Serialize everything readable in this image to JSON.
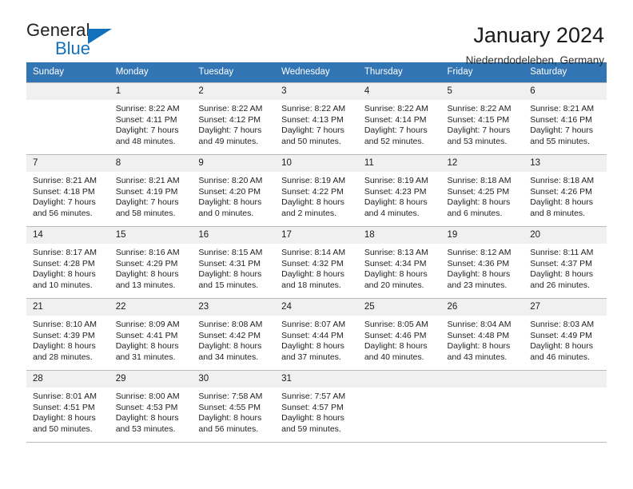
{
  "brand": {
    "name_dark": "General",
    "name_blue": "Blue",
    "accent_color": "#1271ba"
  },
  "header": {
    "title": "January 2024",
    "subtitle": "Niederndodeleben, Germany",
    "header_bg_color": "#3275b4",
    "daynum_bg_color": "#f0f0f0"
  },
  "weekday_headers": [
    "Sunday",
    "Monday",
    "Tuesday",
    "Wednesday",
    "Thursday",
    "Friday",
    "Saturday"
  ],
  "labels": {
    "sunrise_prefix": "Sunrise:",
    "sunset_prefix": "Sunset:",
    "daylight_prefix": "Daylight:"
  },
  "weeks": [
    [
      {
        "day": "",
        "blank": true,
        "line1": "",
        "line2": "",
        "line3": "",
        "line4": ""
      },
      {
        "day": "1",
        "line1": "Sunrise: 8:22 AM",
        "line2": "Sunset: 4:11 PM",
        "line3": "Daylight: 7 hours",
        "line4": "and 48 minutes."
      },
      {
        "day": "2",
        "line1": "Sunrise: 8:22 AM",
        "line2": "Sunset: 4:12 PM",
        "line3": "Daylight: 7 hours",
        "line4": "and 49 minutes."
      },
      {
        "day": "3",
        "line1": "Sunrise: 8:22 AM",
        "line2": "Sunset: 4:13 PM",
        "line3": "Daylight: 7 hours",
        "line4": "and 50 minutes."
      },
      {
        "day": "4",
        "line1": "Sunrise: 8:22 AM",
        "line2": "Sunset: 4:14 PM",
        "line3": "Daylight: 7 hours",
        "line4": "and 52 minutes."
      },
      {
        "day": "5",
        "line1": "Sunrise: 8:22 AM",
        "line2": "Sunset: 4:15 PM",
        "line3": "Daylight: 7 hours",
        "line4": "and 53 minutes."
      },
      {
        "day": "6",
        "line1": "Sunrise: 8:21 AM",
        "line2": "Sunset: 4:16 PM",
        "line3": "Daylight: 7 hours",
        "line4": "and 55 minutes."
      }
    ],
    [
      {
        "day": "7",
        "line1": "Sunrise: 8:21 AM",
        "line2": "Sunset: 4:18 PM",
        "line3": "Daylight: 7 hours",
        "line4": "and 56 minutes."
      },
      {
        "day": "8",
        "line1": "Sunrise: 8:21 AM",
        "line2": "Sunset: 4:19 PM",
        "line3": "Daylight: 7 hours",
        "line4": "and 58 minutes."
      },
      {
        "day": "9",
        "line1": "Sunrise: 8:20 AM",
        "line2": "Sunset: 4:20 PM",
        "line3": "Daylight: 8 hours",
        "line4": "and 0 minutes."
      },
      {
        "day": "10",
        "line1": "Sunrise: 8:19 AM",
        "line2": "Sunset: 4:22 PM",
        "line3": "Daylight: 8 hours",
        "line4": "and 2 minutes."
      },
      {
        "day": "11",
        "line1": "Sunrise: 8:19 AM",
        "line2": "Sunset: 4:23 PM",
        "line3": "Daylight: 8 hours",
        "line4": "and 4 minutes."
      },
      {
        "day": "12",
        "line1": "Sunrise: 8:18 AM",
        "line2": "Sunset: 4:25 PM",
        "line3": "Daylight: 8 hours",
        "line4": "and 6 minutes."
      },
      {
        "day": "13",
        "line1": "Sunrise: 8:18 AM",
        "line2": "Sunset: 4:26 PM",
        "line3": "Daylight: 8 hours",
        "line4": "and 8 minutes."
      }
    ],
    [
      {
        "day": "14",
        "line1": "Sunrise: 8:17 AM",
        "line2": "Sunset: 4:28 PM",
        "line3": "Daylight: 8 hours",
        "line4": "and 10 minutes."
      },
      {
        "day": "15",
        "line1": "Sunrise: 8:16 AM",
        "line2": "Sunset: 4:29 PM",
        "line3": "Daylight: 8 hours",
        "line4": "and 13 minutes."
      },
      {
        "day": "16",
        "line1": "Sunrise: 8:15 AM",
        "line2": "Sunset: 4:31 PM",
        "line3": "Daylight: 8 hours",
        "line4": "and 15 minutes."
      },
      {
        "day": "17",
        "line1": "Sunrise: 8:14 AM",
        "line2": "Sunset: 4:32 PM",
        "line3": "Daylight: 8 hours",
        "line4": "and 18 minutes."
      },
      {
        "day": "18",
        "line1": "Sunrise: 8:13 AM",
        "line2": "Sunset: 4:34 PM",
        "line3": "Daylight: 8 hours",
        "line4": "and 20 minutes."
      },
      {
        "day": "19",
        "line1": "Sunrise: 8:12 AM",
        "line2": "Sunset: 4:36 PM",
        "line3": "Daylight: 8 hours",
        "line4": "and 23 minutes."
      },
      {
        "day": "20",
        "line1": "Sunrise: 8:11 AM",
        "line2": "Sunset: 4:37 PM",
        "line3": "Daylight: 8 hours",
        "line4": "and 26 minutes."
      }
    ],
    [
      {
        "day": "21",
        "line1": "Sunrise: 8:10 AM",
        "line2": "Sunset: 4:39 PM",
        "line3": "Daylight: 8 hours",
        "line4": "and 28 minutes."
      },
      {
        "day": "22",
        "line1": "Sunrise: 8:09 AM",
        "line2": "Sunset: 4:41 PM",
        "line3": "Daylight: 8 hours",
        "line4": "and 31 minutes."
      },
      {
        "day": "23",
        "line1": "Sunrise: 8:08 AM",
        "line2": "Sunset: 4:42 PM",
        "line3": "Daylight: 8 hours",
        "line4": "and 34 minutes."
      },
      {
        "day": "24",
        "line1": "Sunrise: 8:07 AM",
        "line2": "Sunset: 4:44 PM",
        "line3": "Daylight: 8 hours",
        "line4": "and 37 minutes."
      },
      {
        "day": "25",
        "line1": "Sunrise: 8:05 AM",
        "line2": "Sunset: 4:46 PM",
        "line3": "Daylight: 8 hours",
        "line4": "and 40 minutes."
      },
      {
        "day": "26",
        "line1": "Sunrise: 8:04 AM",
        "line2": "Sunset: 4:48 PM",
        "line3": "Daylight: 8 hours",
        "line4": "and 43 minutes."
      },
      {
        "day": "27",
        "line1": "Sunrise: 8:03 AM",
        "line2": "Sunset: 4:49 PM",
        "line3": "Daylight: 8 hours",
        "line4": "and 46 minutes."
      }
    ],
    [
      {
        "day": "28",
        "line1": "Sunrise: 8:01 AM",
        "line2": "Sunset: 4:51 PM",
        "line3": "Daylight: 8 hours",
        "line4": "and 50 minutes."
      },
      {
        "day": "29",
        "line1": "Sunrise: 8:00 AM",
        "line2": "Sunset: 4:53 PM",
        "line3": "Daylight: 8 hours",
        "line4": "and 53 minutes."
      },
      {
        "day": "30",
        "line1": "Sunrise: 7:58 AM",
        "line2": "Sunset: 4:55 PM",
        "line3": "Daylight: 8 hours",
        "line4": "and 56 minutes."
      },
      {
        "day": "31",
        "line1": "Sunrise: 7:57 AM",
        "line2": "Sunset: 4:57 PM",
        "line3": "Daylight: 8 hours",
        "line4": "and 59 minutes."
      },
      {
        "day": "",
        "blank": true,
        "line1": "",
        "line2": "",
        "line3": "",
        "line4": ""
      },
      {
        "day": "",
        "blank": true,
        "line1": "",
        "line2": "",
        "line3": "",
        "line4": ""
      },
      {
        "day": "",
        "blank": true,
        "line1": "",
        "line2": "",
        "line3": "",
        "line4": ""
      }
    ]
  ]
}
